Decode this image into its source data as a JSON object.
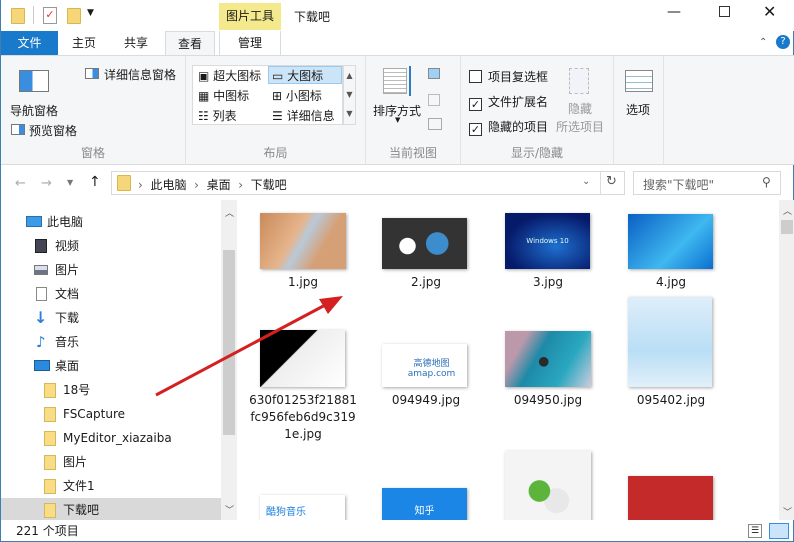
{
  "window": {
    "title": "下载吧",
    "context_tab_group": "图片工具"
  },
  "tabs": [
    {
      "label": "文件"
    },
    {
      "label": "主页"
    },
    {
      "label": "共享"
    },
    {
      "label": "查看"
    },
    {
      "label": "管理"
    }
  ],
  "ribbon": {
    "panes": {
      "nav_pane": "导航窗格",
      "preview_pane": "预览窗格",
      "details_pane": "详细信息窗格",
      "group": "窗格"
    },
    "layout": {
      "items": [
        "超大图标",
        "大图标",
        "中图标",
        "小图标",
        "列表",
        "详细信息"
      ],
      "selected": "大图标",
      "group": "布局"
    },
    "current_view": {
      "sort": "排序方式",
      "group": "当前视图"
    },
    "show_hide": {
      "item_checkboxes": "项目复选框",
      "item_checkboxes_checked": false,
      "file_extensions": "文件扩展名",
      "file_extensions_checked": true,
      "hidden_items": "隐藏的项目",
      "hidden_items_checked": true,
      "hide_selected_1": "隐藏",
      "hide_selected_2": "所选项目",
      "group": "显示/隐藏"
    },
    "options": "选项"
  },
  "address": {
    "crumbs": [
      "此电脑",
      "桌面",
      "下载吧"
    ],
    "search_placeholder": "搜索\"下载吧\""
  },
  "nav": {
    "items": [
      {
        "label": "此电脑"
      },
      {
        "label": "视频"
      },
      {
        "label": "图片"
      },
      {
        "label": "文档"
      },
      {
        "label": "下载"
      },
      {
        "label": "音乐"
      },
      {
        "label": "桌面"
      },
      {
        "label": "18号"
      },
      {
        "label": "FSCapture"
      },
      {
        "label": "MyEditor_xiazaiba"
      },
      {
        "label": "图片"
      },
      {
        "label": "文件1"
      },
      {
        "label": "下载吧"
      }
    ],
    "selected": "下载吧"
  },
  "files": [
    {
      "name": "1.jpg"
    },
    {
      "name": "2.jpg"
    },
    {
      "name": "3.jpg"
    },
    {
      "name": "4.jpg"
    },
    {
      "name": "630f01253f21881fc956feb6d9c3191e.jpg"
    },
    {
      "name": "094949.jpg"
    },
    {
      "name": "094950.jpg"
    },
    {
      "name": "095402.jpg"
    }
  ],
  "thumb_text": {
    "win10": "Windows 10",
    "amap": "高德地图 amap.com",
    "kugou": "酷狗音乐",
    "zhihu": "知乎"
  },
  "status": {
    "count": "221 个项目"
  },
  "colors": {
    "accent": "#1979ca",
    "annotation_arrow": "#d42020"
  }
}
